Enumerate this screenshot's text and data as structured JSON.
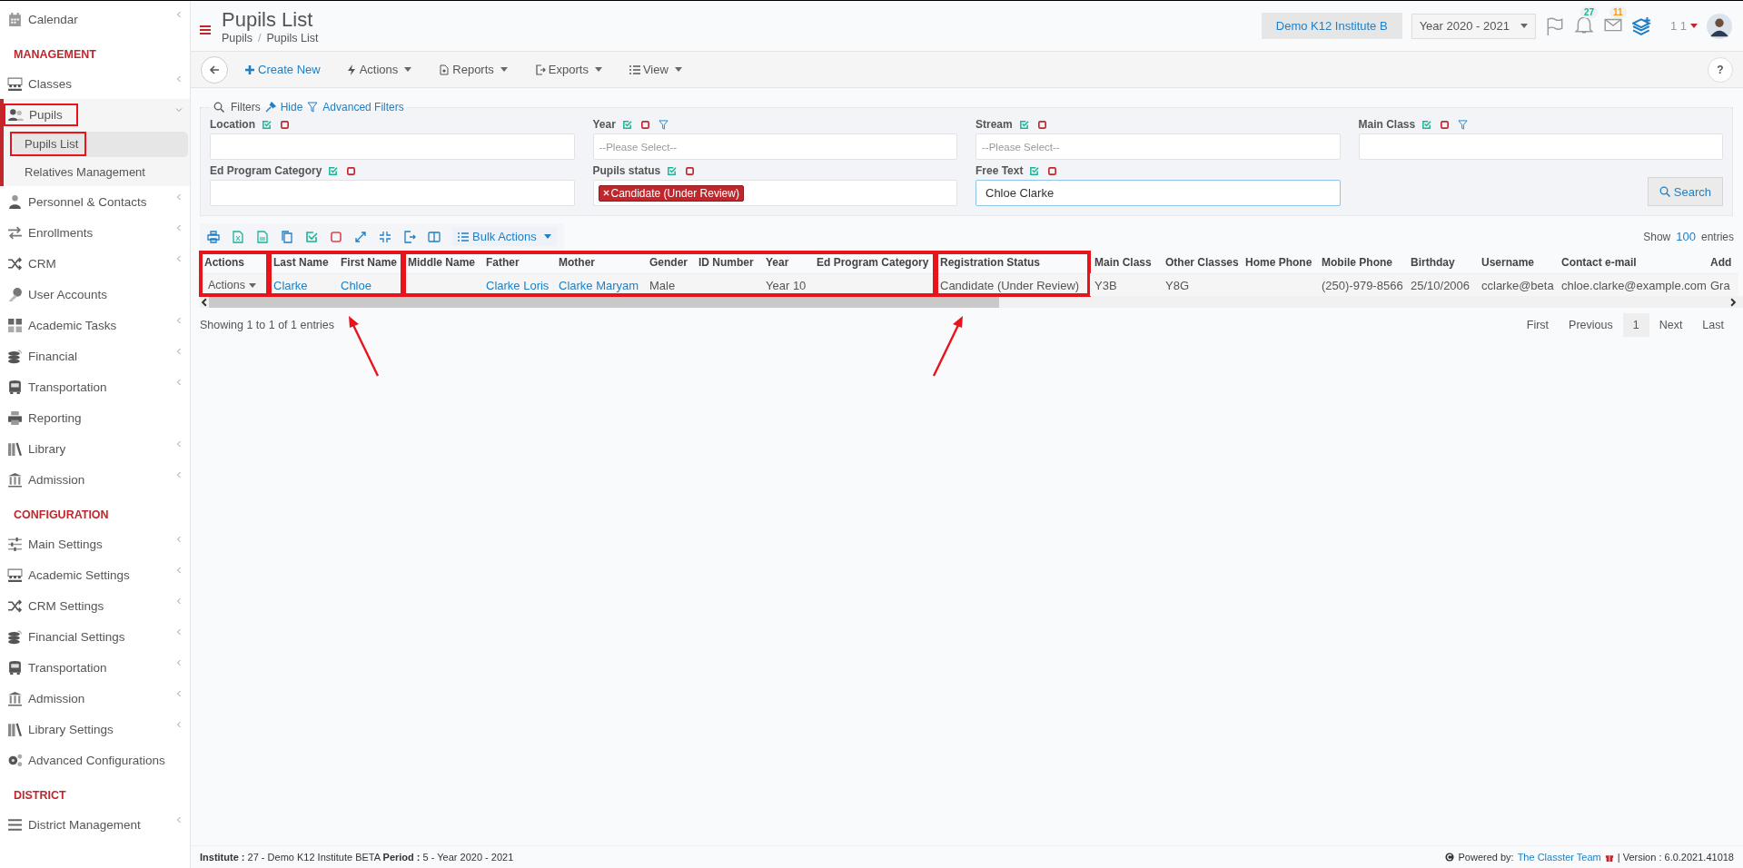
{
  "sidebar": {
    "sections": [
      {
        "items": [
          {
            "label": "Calendar",
            "has_submenu": true,
            "selected": false,
            "expanded": false,
            "outlined": false
          }
        ]
      },
      {
        "heading": "MANAGEMENT",
        "items": [
          {
            "label": "Classes",
            "has_submenu": true,
            "selected": false,
            "expanded": false,
            "outlined": false
          },
          {
            "label": "Pupils",
            "has_submenu": true,
            "selected": true,
            "expanded": true,
            "outlined": true,
            "children": [
              {
                "label": "Pupils List",
                "selected": true,
                "outlined": true
              },
              {
                "label": "Relatives Management",
                "selected": false,
                "outlined": false
              }
            ]
          },
          {
            "label": "Personnel & Contacts",
            "has_submenu": true,
            "selected": false,
            "expanded": false,
            "outlined": false
          },
          {
            "label": "Enrollments",
            "has_submenu": true,
            "selected": false,
            "expanded": false,
            "outlined": false
          },
          {
            "label": "CRM",
            "has_submenu": true,
            "selected": false,
            "expanded": false,
            "outlined": false
          },
          {
            "label": "User Accounts",
            "has_submenu": false,
            "selected": false,
            "outlined": false
          },
          {
            "label": "Academic Tasks",
            "has_submenu": true,
            "selected": false,
            "expanded": false,
            "outlined": false
          },
          {
            "label": "Financial",
            "has_submenu": true,
            "selected": false,
            "expanded": false,
            "outlined": false
          },
          {
            "label": "Transportation",
            "has_submenu": true,
            "selected": false,
            "expanded": false,
            "outlined": false
          },
          {
            "label": "Reporting",
            "has_submenu": false,
            "selected": false,
            "outlined": false
          },
          {
            "label": "Library",
            "has_submenu": true,
            "selected": false,
            "expanded": false,
            "outlined": false
          },
          {
            "label": "Admission",
            "has_submenu": true,
            "selected": false,
            "expanded": false,
            "outlined": false
          }
        ]
      },
      {
        "heading": "CONFIGURATION",
        "items": [
          {
            "label": "Main Settings",
            "has_submenu": true,
            "selected": false,
            "expanded": false,
            "outlined": false
          },
          {
            "label": "Academic Settings",
            "has_submenu": true,
            "selected": false,
            "expanded": false,
            "outlined": false
          },
          {
            "label": "CRM Settings",
            "has_submenu": true,
            "selected": false,
            "expanded": false,
            "outlined": false
          },
          {
            "label": "Financial Settings",
            "has_submenu": true,
            "selected": false,
            "expanded": false,
            "outlined": false
          },
          {
            "label": "Transportation",
            "has_submenu": true,
            "selected": false,
            "expanded": false,
            "outlined": false
          },
          {
            "label": "Admission",
            "has_submenu": true,
            "selected": false,
            "expanded": false,
            "outlined": false
          },
          {
            "label": "Library Settings",
            "has_submenu": true,
            "selected": false,
            "expanded": false,
            "outlined": false
          },
          {
            "label": "Advanced Configurations",
            "has_submenu": false,
            "selected": false,
            "outlined": false
          }
        ]
      },
      {
        "heading": "DISTRICT",
        "items": [
          {
            "label": "District Management",
            "has_submenu": true,
            "selected": false,
            "expanded": false,
            "outlined": false
          }
        ]
      }
    ]
  },
  "header": {
    "title": "Pupils List",
    "breadcrumbs": [
      "Pupils",
      "Pupils List"
    ],
    "breadcrumb_separator": "/",
    "institute": "Demo K12 Institute B",
    "year": "Year 2020 - 2021",
    "notifications": "27",
    "messages": "11",
    "user": "1 1"
  },
  "toolbar": {
    "buttons": [
      {
        "label": "Create New",
        "kind": "create"
      },
      {
        "label": "Actions",
        "kind": "menu"
      },
      {
        "label": "Reports",
        "kind": "menu"
      },
      {
        "label": "Exports",
        "kind": "menu"
      },
      {
        "label": "View",
        "kind": "menu"
      }
    ],
    "help": "?"
  },
  "filters": {
    "legend": "Filters",
    "hide": "Hide",
    "advanced": "Advanced Filters",
    "fields": [
      {
        "label": "Location",
        "kind": "text",
        "funnel": false,
        "focused": false
      },
      {
        "label": "Year",
        "kind": "select",
        "placeholder": "--Please Select--",
        "funnel": true,
        "focused": false
      },
      {
        "label": "Stream",
        "kind": "select",
        "placeholder": "--Please Select--",
        "funnel": false,
        "focused": false
      },
      {
        "label": "Main Class",
        "kind": "text",
        "funnel": true,
        "focused": false
      },
      {
        "label": "Ed Program Category",
        "kind": "text",
        "funnel": false,
        "focused": false
      },
      {
        "label": "Pupils status",
        "kind": "tags",
        "tags": [
          "Candidate (Under Review)"
        ],
        "funnel": false,
        "focused": false
      },
      {
        "label": "Free Text",
        "kind": "text",
        "value": "Chloe Clarke",
        "funnel": false,
        "focused": true
      }
    ],
    "search": "Search"
  },
  "table": {
    "bulk_actions": "Bulk Actions",
    "show": "Show",
    "page_size": "100",
    "entries": "entries",
    "groups": [
      {
        "outlined": true,
        "arrow": false,
        "columns": [
          {
            "header": "Actions",
            "cell": "Actions",
            "kind": "dropdown"
          }
        ]
      },
      {
        "outlined": true,
        "arrow": true,
        "columns": [
          {
            "header": "Last Name",
            "cell": "Clarke",
            "kind": "link"
          },
          {
            "header": "First Name",
            "cell": "Chloe",
            "kind": "link"
          }
        ]
      },
      {
        "outlined": true,
        "arrow": false,
        "columns": [
          {
            "header": "Middle Name",
            "kind": "text"
          },
          {
            "header": "Father",
            "cell": "Clarke Loris",
            "kind": "link"
          },
          {
            "header": "Mother",
            "cell": "Clarke Maryam",
            "kind": "link"
          },
          {
            "header": "Gender",
            "cell": "Male",
            "kind": "text"
          },
          {
            "header": "ID Number",
            "kind": "text"
          },
          {
            "header": "Year",
            "cell": "Year 10",
            "kind": "text"
          },
          {
            "header": "Ed Program Category",
            "kind": "text"
          }
        ]
      },
      {
        "outlined": true,
        "arrow": true,
        "columns": [
          {
            "header": "Registration Status",
            "cell": "Candidate (Under Review)",
            "kind": "text"
          }
        ]
      },
      {
        "outlined": false,
        "arrow": false,
        "columns": [
          {
            "header": "Main Class",
            "cell": "Y3B",
            "kind": "text"
          },
          {
            "header": "Other Classes",
            "cell": "Y8G",
            "kind": "text"
          },
          {
            "header": "Home Phone",
            "kind": "text"
          },
          {
            "header": "Mobile Phone",
            "cell": "(250)-979-8566",
            "kind": "text"
          },
          {
            "header": "Birthday",
            "cell": "25/10/2006",
            "kind": "text"
          },
          {
            "header": "Username",
            "cell": "cclarke@beta",
            "kind": "text"
          },
          {
            "header": "Contact e-mail",
            "cell": "chloe.clarke@example.com",
            "kind": "text"
          },
          {
            "header": "Add",
            "cell": "Gra",
            "kind": "text"
          }
        ]
      }
    ],
    "summary": "Showing 1 to 1 of 1 entries",
    "pages": [
      {
        "label": "First",
        "selected": false
      },
      {
        "label": "Previous",
        "selected": false
      },
      {
        "label": "1",
        "selected": true
      },
      {
        "label": "Next",
        "selected": false
      },
      {
        "label": "Last",
        "selected": false
      }
    ]
  },
  "footer": {
    "info": "**Institute :** 27 - Demo K12 Institute BETA **Period :** 5 - Year 2020 - 2021",
    "powered": "Powered by:",
    "team": "The Classter Team",
    "version": "| Version : 6.0.2021.41018"
  }
}
